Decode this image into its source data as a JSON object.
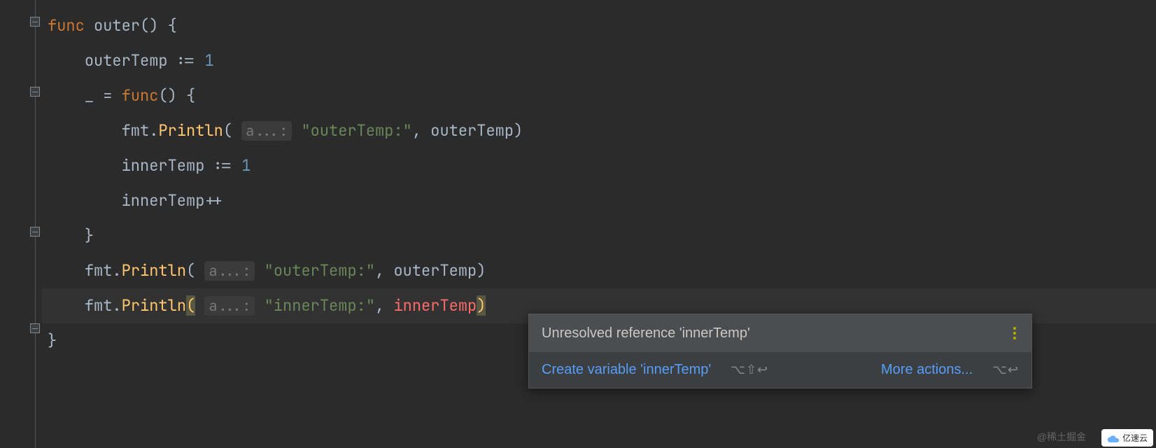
{
  "code": {
    "l1": {
      "kw": "func",
      "name": "outer",
      "brace": "() {"
    },
    "l2": {
      "var": "outerTemp",
      "op": ":=",
      "val": "1"
    },
    "l3": {
      "under": "_",
      "eq": "=",
      "kw": "func",
      "brace": "() {"
    },
    "l4": {
      "pkg": "fmt",
      "fn": "Println",
      "hint": "a...:",
      "str": "\"outerTemp:\"",
      "comma": ",",
      "arg": "outerTemp",
      "close": ")"
    },
    "l5": {
      "var": "innerTemp",
      "op": ":=",
      "val": "1"
    },
    "l6": {
      "var": "innerTemp",
      "op": "++"
    },
    "l7": {
      "brace": "}"
    },
    "l8": {
      "pkg": "fmt",
      "fn": "Println",
      "hint": "a...:",
      "str": "\"outerTemp:\"",
      "comma": ",",
      "arg": "outerTemp",
      "close": ")"
    },
    "l9": {
      "pkg": "fmt",
      "fn": "Println",
      "hint": "a...:",
      "str": "\"innerTemp:\"",
      "comma": ",",
      "arg": "innerTemp",
      "close": ")"
    },
    "l10": {
      "brace": "}"
    }
  },
  "tooltip": {
    "title": "Unresolved reference 'innerTemp'",
    "action1": "Create variable 'innerTemp'",
    "shortcut1": "⌥⇧↩",
    "action2": "More actions...",
    "shortcut2": "⌥↩"
  },
  "watermark1": "@稀土掘金",
  "watermark2": "亿速云"
}
